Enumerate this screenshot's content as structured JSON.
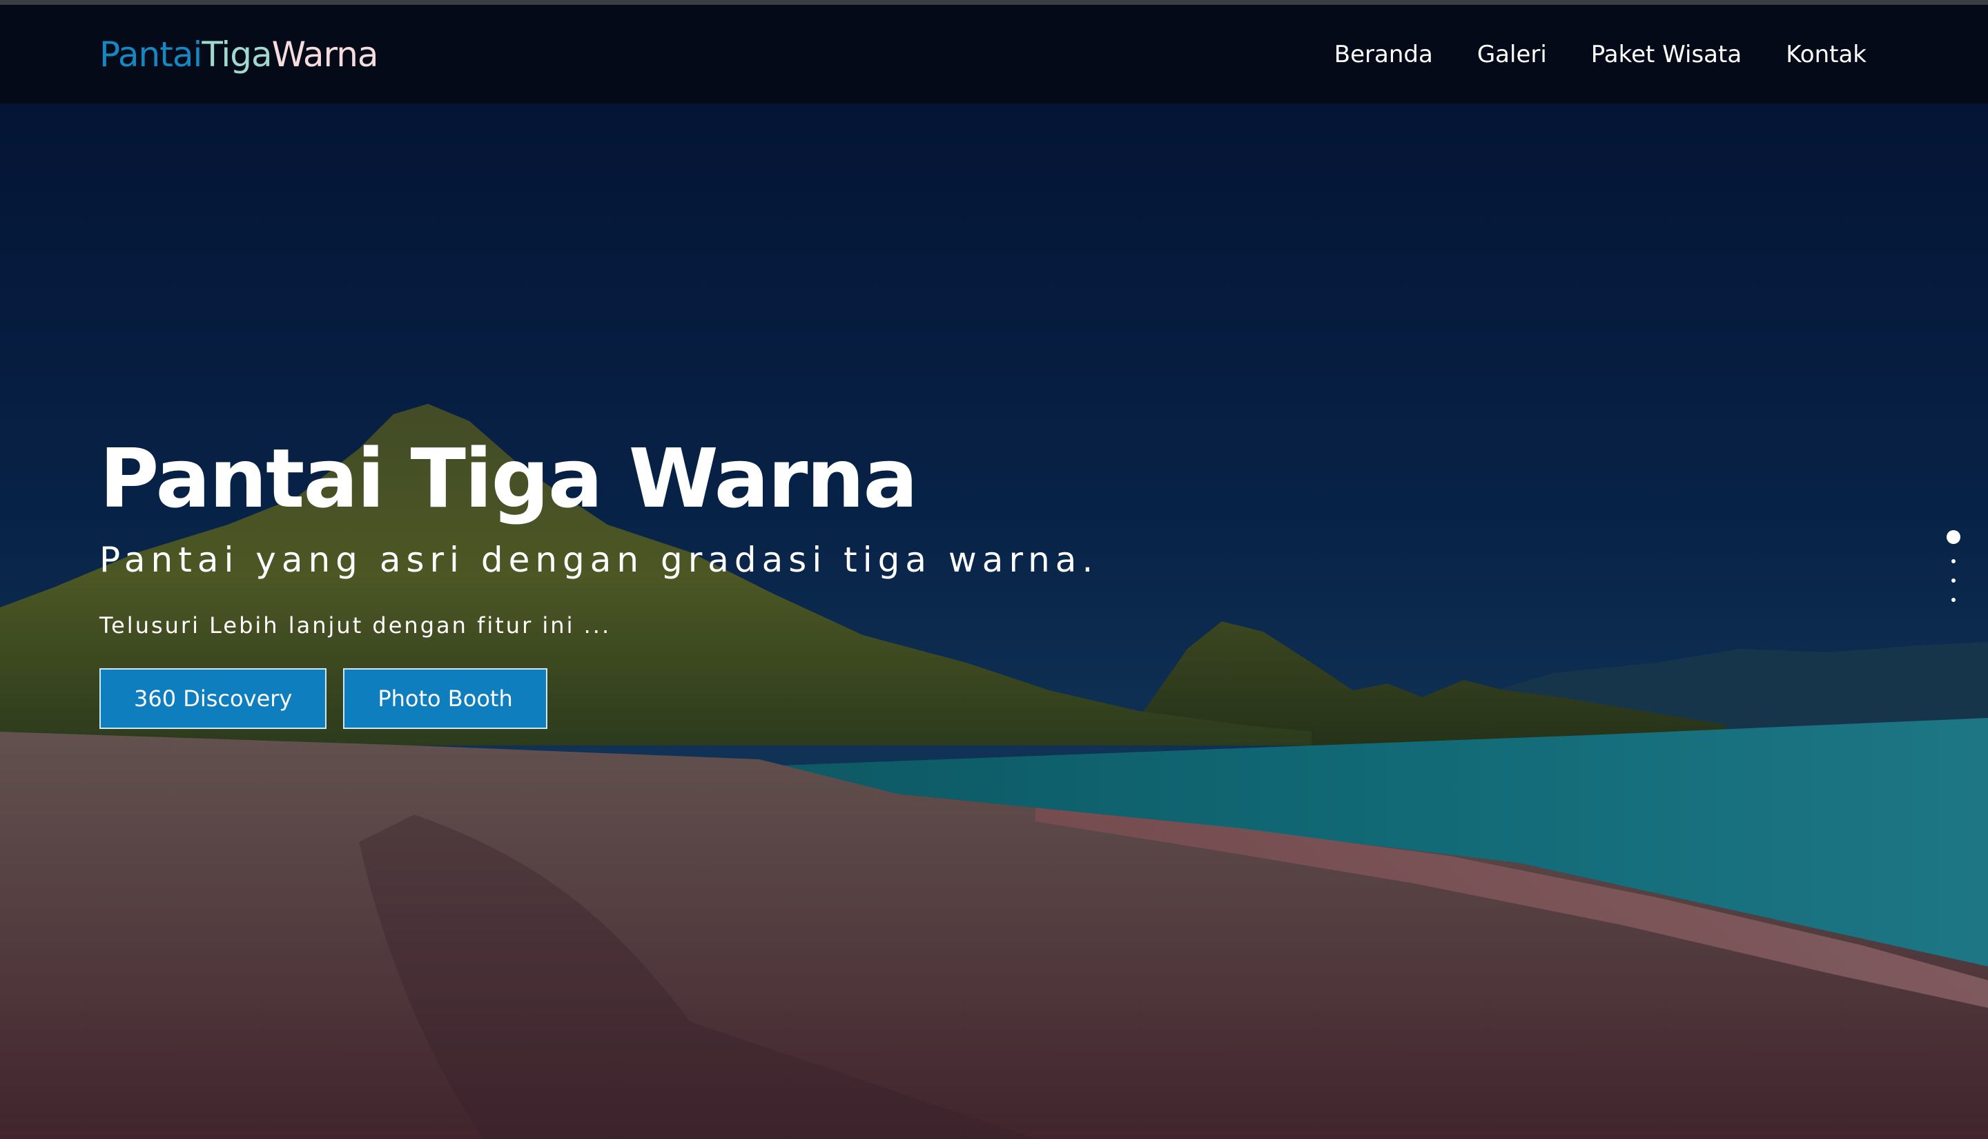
{
  "brand": {
    "part1": "Pantai",
    "part2": "Tiga",
    "part3": "Warna"
  },
  "nav": {
    "items": [
      {
        "label": "Beranda"
      },
      {
        "label": "Galeri"
      },
      {
        "label": "Paket Wisata"
      },
      {
        "label": "Kontak"
      }
    ]
  },
  "hero": {
    "title": "Pantai Tiga Warna",
    "subtitle": "Pantai yang asri dengan gradasi tiga warna.",
    "lead": "Telusuri Lebih lanjut dengan fitur ini ...",
    "buttons": [
      {
        "label": "360 Discovery"
      },
      {
        "label": "Photo Booth"
      }
    ]
  },
  "carousel": {
    "slide_count": 4,
    "active_index": 0
  },
  "colors": {
    "brand_blue": "#1588c2",
    "brand_teal": "#9fd9cf",
    "brand_pink": "#f6dcdc",
    "button_blue": "#0f7ebf",
    "navbar_bg": "#040a17"
  }
}
